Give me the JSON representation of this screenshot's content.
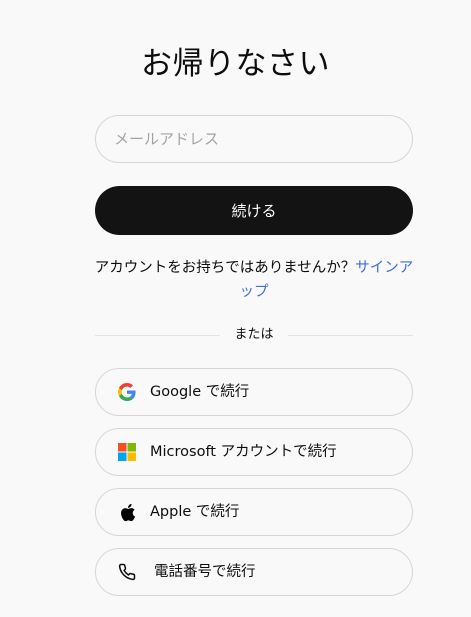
{
  "header": {
    "title": "お帰りなさい"
  },
  "form": {
    "email_placeholder": "メールアドレス",
    "email_value": "",
    "continue_label": "続ける"
  },
  "signup": {
    "prompt": "アカウントをお持ちではありませんか？",
    "link_label": "サインアップ"
  },
  "divider": {
    "label": "または"
  },
  "sso": {
    "google": {
      "label": "Google で続行",
      "icon": "google-icon"
    },
    "microsoft": {
      "label": "Microsoft アカウントで続行",
      "icon": "microsoft-icon"
    },
    "apple": {
      "label": "Apple で続行",
      "icon": "apple-icon"
    },
    "phone": {
      "label": "電話番号で続行",
      "icon": "phone-icon"
    }
  },
  "colors": {
    "background": "#f9f9f9",
    "primary_button": "#131313",
    "link": "#3e6fd6",
    "border": "#d6d6d6"
  }
}
